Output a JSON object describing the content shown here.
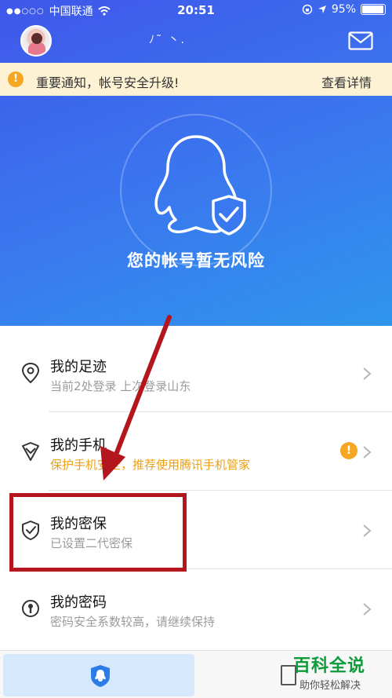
{
  "status_bar": {
    "signal": "●●○○○",
    "carrier": "中国联通",
    "time": "20:51",
    "battery": "95%",
    "battery_level": 0.95
  },
  "header": {
    "nickname": "ﾉ˜ 丶."
  },
  "notice": {
    "icon": "!",
    "text": "重要通知，帐号安全升级!",
    "link": "查看详情"
  },
  "hero": {
    "status": "您的帐号暂无风险"
  },
  "list": [
    {
      "title": "我的足迹",
      "subtitle": "当前2处登录 上次登录山东",
      "icon": "location-pin-icon"
    },
    {
      "title": "我的手机",
      "subtitle": "保护手机安全，推荐使用腾讯手机管家",
      "icon": "shield-check-outline-icon",
      "warning": "!"
    },
    {
      "title": "我的密保",
      "subtitle": "已设置二代密保",
      "icon": "shield-check-icon"
    },
    {
      "title": "我的密码",
      "subtitle": "密码安全系数较高，请继续保持",
      "icon": "key-icon"
    }
  ],
  "watermark": {
    "title": "百科全说",
    "subtitle": "助你轻松解决"
  },
  "colors": {
    "accent": "#3a78ef",
    "warning": "#f5a623",
    "annotation": "#b3161d"
  }
}
